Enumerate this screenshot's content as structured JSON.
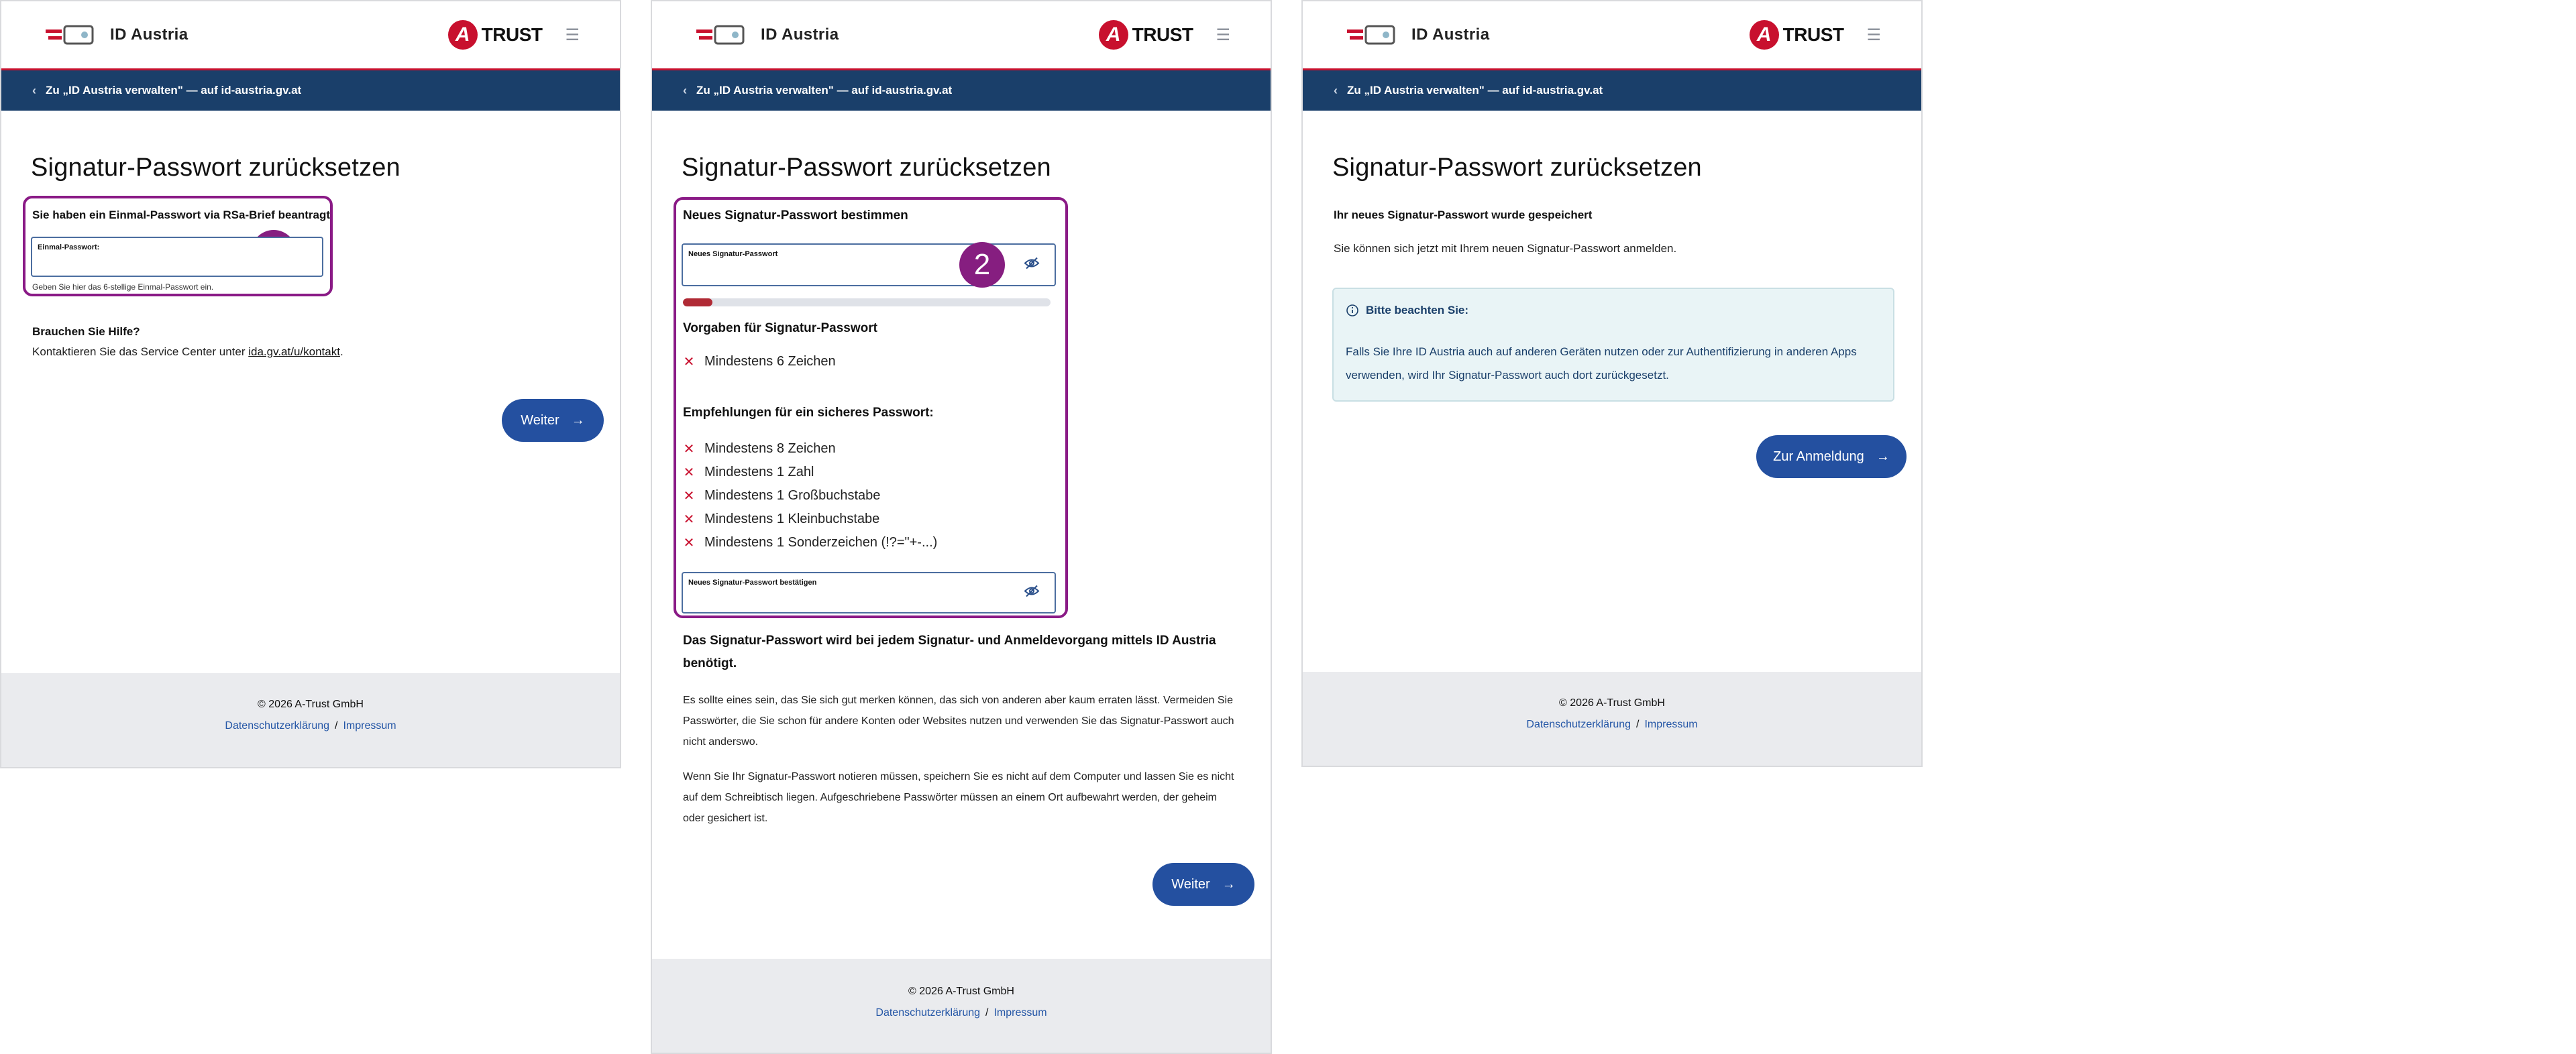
{
  "header": {
    "logo_text": "ID Austria",
    "brand_letter": "A",
    "brand_text": "TRUST",
    "menu_icon": "hamburger-icon"
  },
  "nav": {
    "back_link": "Zu „ID Austria verwalten\" — auf id-austria.gv.at"
  },
  "title": "Signatur-Passwort zurücksetzen",
  "colors": {
    "nav_bg": "#1a3f6a",
    "accent_red": "#c8102e",
    "highlight": "#8a1a86",
    "button": "#2450a0",
    "link": "#2456a6"
  },
  "footer": {
    "copyright": "© 2026 A-Trust GmbH",
    "privacy": "Datenschutzerklärung",
    "separator": "/",
    "imprint": "Impressum"
  },
  "step1": {
    "badge": "1",
    "subtitle": "Sie haben ein Einmal-Passwort via RSa-Brief beantragt",
    "field_label": "Einmal-Passwort:",
    "field_value": "",
    "hint": "Geben Sie hier das 6-stellige Einmal-Passwort ein.",
    "help_title": "Brauchen Sie Hilfe?",
    "help_text": "Kontaktieren Sie das Service Center unter ",
    "help_link": "ida.gv.at/u/kontakt",
    "help_end": ".",
    "button": "Weiter"
  },
  "step2": {
    "badge": "2",
    "subtitle": "Neues Signatur-Passwort bestimmen",
    "field_label": "Neues Signatur-Passwort",
    "strength_fraction": 0.08,
    "requirements_title": "Vorgaben für Signatur-Passwort",
    "requirements": [
      "Mindestens 6 Zeichen"
    ],
    "recommendations_title": "Empfehlungen für ein sicheres Passwort:",
    "recommendations": [
      "Mindestens 8 Zeichen",
      "Mindestens 1 Zahl",
      "Mindestens 1 Großbuchstabe",
      "Mindestens 1 Kleinbuchstabe",
      "Mindestens 1 Sonderzeichen (!?=\"+-...)"
    ],
    "confirm_label": "Neues Signatur-Passwort bestätigen",
    "info_title": "Das Signatur-Passwort wird bei jedem Signatur- und Anmeldevorgang mittels ID Austria benötigt.",
    "para1": "Es sollte eines sein, das Sie sich gut merken können, das sich von anderen aber kaum erraten lässt. Vermeiden Sie Passwörter, die Sie schon für andere Konten oder Websites nutzen und verwenden Sie das Signatur-Passwort auch nicht anderswo.",
    "para2": "Wenn Sie Ihr Signatur-Passwort notieren müssen, speichern Sie es nicht auf dem Computer und lassen Sie es nicht auf dem Schreibtisch liegen. Aufgeschriebene Passwörter müssen an einem Ort aufbewahrt werden, der geheim oder gesichert ist.",
    "button": "Weiter"
  },
  "step3": {
    "subtitle": "Ihr neues Signatur-Passwort wurde gespeichert",
    "text": "Sie können sich jetzt mit Ihrem neuen Signatur-Passwort anmelden.",
    "info_title": "Bitte beachten Sie:",
    "info_text": "Falls Sie Ihre ID Austria auch auf anderen Geräten nutzen oder zur Authentifizierung in anderen Apps verwenden, wird Ihr Signatur-Passwort auch dort zurückgesetzt.",
    "button": "Zur Anmeldung"
  }
}
